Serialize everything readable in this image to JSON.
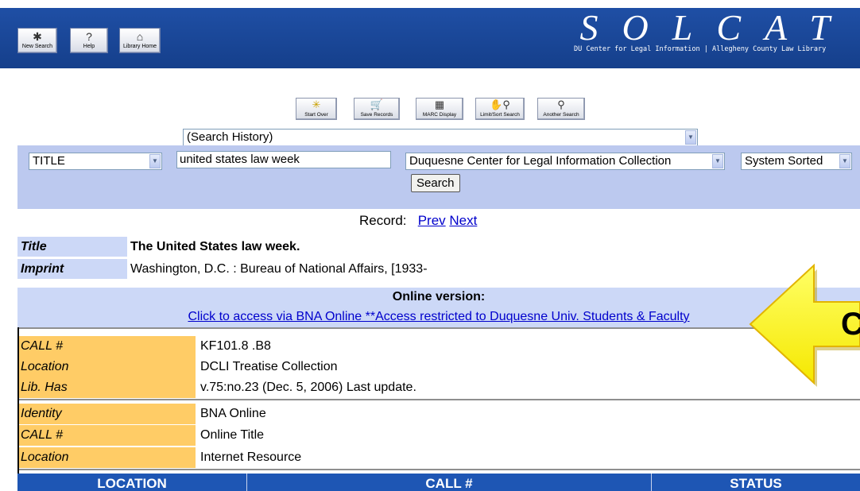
{
  "header": {
    "logo": "SOLCAT",
    "tagline": "DU Center for Legal Information | Allegheny County Law Library",
    "nav": [
      {
        "label": "New Search",
        "icon": "new-search-icon"
      },
      {
        "label": "Help",
        "icon": "help-icon"
      },
      {
        "label": "Library Home",
        "icon": "home-icon"
      }
    ]
  },
  "toolbar": {
    "start_over": "Start Over",
    "save_records": "Save Records",
    "marc_display": "MARC Display",
    "limit_sort": "Limit/Sort Search",
    "another_search": "Another Search"
  },
  "search": {
    "history": "(Search History)",
    "index": "TITLE",
    "query": "united states law week",
    "collection": "Duquesne Center for Legal Information Collection",
    "sort": "System Sorted",
    "button": "Search"
  },
  "record_nav": {
    "label": "Record:",
    "prev": "Prev",
    "next": "Next"
  },
  "bib": {
    "title_label": "Title",
    "title_value": "The United States law week.",
    "imprint_label": "Imprint",
    "imprint_value": "Washington, D.C. : Bureau of National Affairs, [1933-"
  },
  "online": {
    "heading": "Online version:",
    "link": "Click to access via BNA Online **Access restricted to Duquesne Univ. Students & Faculty"
  },
  "holdings": [
    {
      "label": "CALL #",
      "value": "KF101.8 .B8"
    },
    {
      "label": "Location",
      "value": "DCLI Treatise Collection"
    },
    {
      "label": "Lib. Has",
      "value": "v.75:no.23 (Dec. 5, 2006) Last update."
    },
    {
      "label": "Identity",
      "value": "BNA Online"
    },
    {
      "label": "CALL #",
      "value": "Online Title"
    },
    {
      "label": "Location",
      "value": "Internet Resource"
    }
  ],
  "table_header": {
    "location": "LOCATION",
    "call": "CALL #",
    "status": "STATUS"
  },
  "callout_text": "C",
  "colors": {
    "header_blue": "#1f4fa5",
    "panel_blue": "#bcc9ef",
    "label_blue": "#ccd8f7",
    "holding_orange": "#ffcc66",
    "arrow_yellow": "#ffff33",
    "link": "#0000cc"
  }
}
